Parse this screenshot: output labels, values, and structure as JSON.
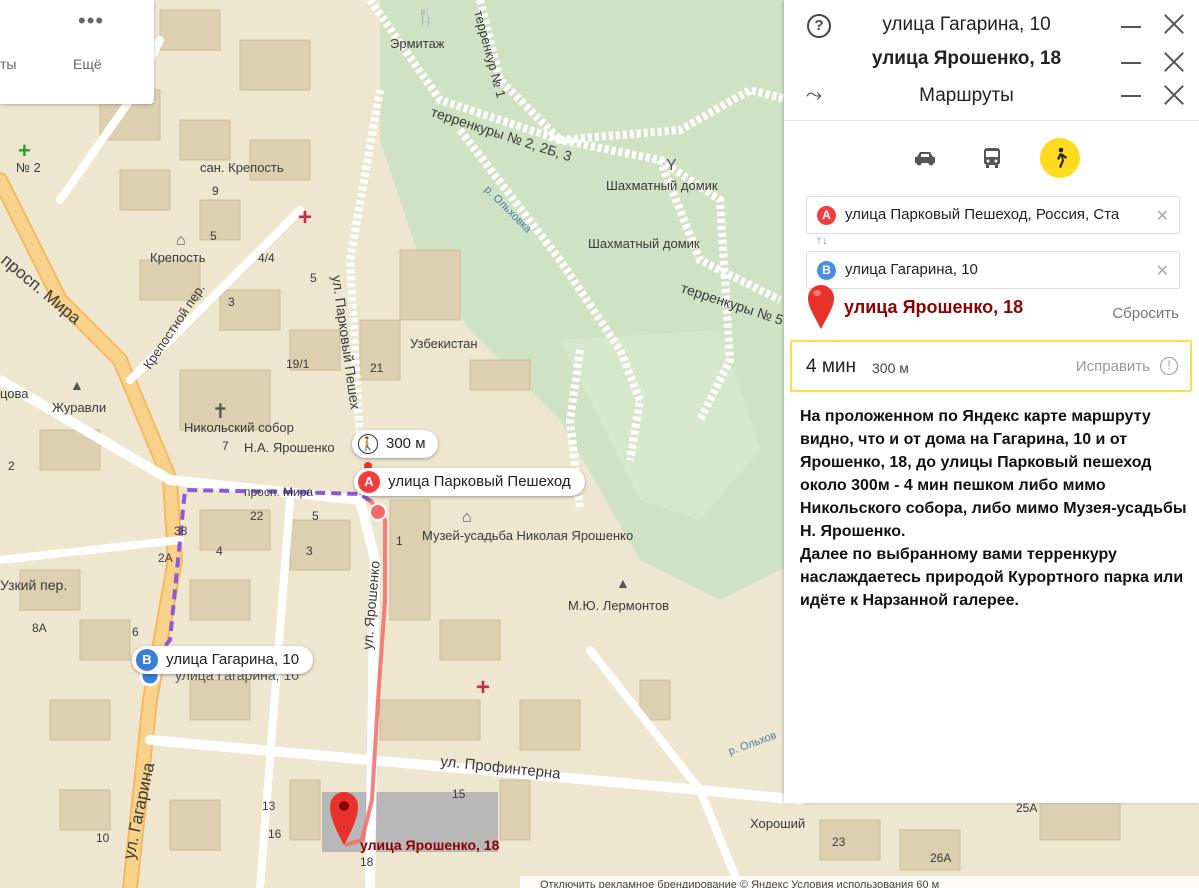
{
  "topbar": {
    "partial_label": "ты",
    "more_label": "Ещё",
    "more_icon": "ellipsis-icon"
  },
  "panel": {
    "help_icon": "question-icon",
    "title_primary": "улица Гагарина, 10",
    "title_annotation": "улица Ярошенко, 18",
    "routes_icon": "route-icon",
    "routes_title": "Маршруты",
    "modes": [
      {
        "name": "car",
        "icon": "car-icon",
        "active": false
      },
      {
        "name": "bus",
        "icon": "bus-icon",
        "active": false
      },
      {
        "name": "walk",
        "icon": "pedestrian-icon",
        "active": true
      }
    ],
    "point_a": {
      "badge": "A",
      "value": "улица Парковый Пешеход, Россия, Ста",
      "color": "#f33d3d"
    },
    "swap_glyph": "↑↓",
    "point_b": {
      "badge": "B",
      "value": "улица Гагарина, 10",
      "color": "#4a90e2"
    },
    "annotation_dest": "улица Ярошенко, 18",
    "reset_label": "Сбросить",
    "summary": {
      "time": "4 мин",
      "distance": "300 м",
      "fix_label": "Исправить"
    },
    "comment": "На проложенном по Яндекс карте маршруту видно, что и от дома на Гагарина, 10 и от Ярошенко, 18, до улицы Парковый пешеход около 300м - 4 мин пешком либо мимо Никольского собора, либо мимо Музея-усадьбы Н. Ярошенко.\nДалее по выбранному вами терренкуру наслаждаетесь природой Курортного парка или идёте к Нарзанной галерее.",
    "accent_color": "#ffcc00"
  },
  "map": {
    "walk_bubble": "300 м",
    "a_bubble": {
      "badge": "A",
      "label": "улица Парковый Пешеход"
    },
    "b_bubble": {
      "badge": "B",
      "label": "улица Гагарина, 10"
    },
    "b_label_under": "улица Гагарина, 10",
    "dest_label": "улица Ярошенко, 18",
    "labels": {
      "ermitazh": "Эрмитаж",
      "terrenkur1": "терренкур № 1",
      "terrenkury2": "терренкуры № 2, 2Б, 3",
      "terrenkury_right": "терренкуры № 5",
      "shakhmat1": "Шахматный домик",
      "shakhmat2": "Шахматный домик",
      "olkhovka": "р. Ольховка",
      "olkhovka2": "р. Ольхов",
      "krepost_san": "сан. Крепость",
      "krepost": "Крепость",
      "krepostnoy": "Крепостной пер.",
      "mira": "просп. Мира",
      "parkovy": "ул. Парковый Пешех",
      "uzbekistan": "Узбекистан",
      "zhuravli": "Журавли",
      "nikolsky": "Никольский собор",
      "yaroshenko_ha": "Н.А. Ярошенко",
      "prosp_mira2": "просп. Мира",
      "museum": "Музей-усадьба Николая Ярошенко",
      "yaroshenko_st": "ул. Ярошенко",
      "lermontov": "М.Ю. Лермонтов",
      "uzky": "Узкий пер.",
      "gagarina": "ул. Гагарина",
      "profintern": "ул. Профинтерна",
      "khoroshy": "Хороший",
      "kovaya": "цова",
      "no2": "№ 2",
      "bottom_strip": "Отключить рекламное брендирование   © Яндекс Условия использования   60 м"
    },
    "house_numbers": [
      "9",
      "5",
      "4/4",
      "5",
      "3",
      "19/1",
      "21",
      "7",
      "22",
      "38",
      "2А",
      "8А",
      "6",
      "1",
      "4",
      "13",
      "16",
      "15",
      "25А",
      "26А",
      "23",
      "10",
      "18",
      "5",
      "3",
      "2"
    ]
  }
}
